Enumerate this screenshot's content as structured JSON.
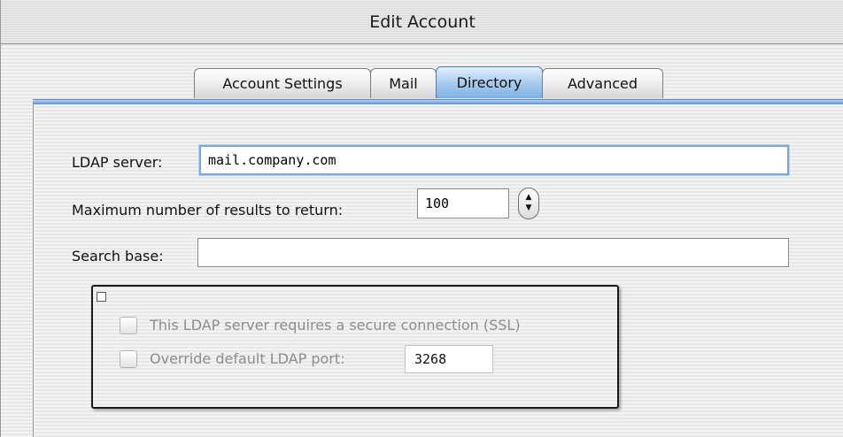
{
  "window": {
    "title": "Edit Account"
  },
  "tabs": [
    {
      "label": "Account Settings",
      "selected": false
    },
    {
      "label": "Mail",
      "selected": false
    },
    {
      "label": "Directory",
      "selected": true
    },
    {
      "label": "Advanced",
      "selected": false
    }
  ],
  "directory": {
    "ldap_server_label": "LDAP server:",
    "ldap_server_value": "mail.company.com",
    "max_results_label": "Maximum number of results to return:",
    "max_results_value": "100",
    "search_base_label": "Search base:",
    "search_base_value": "",
    "ssl_label": "This LDAP server requires a secure connection (SSL)",
    "ssl_checked": false,
    "override_port_label": "Override default LDAP port:",
    "override_port_checked": false,
    "port_value": "3268"
  },
  "icons": {
    "stepper_up": "▲",
    "stepper_down": "▼"
  },
  "colors": {
    "selected_tab": "#a9cdf0",
    "focus_ring": "#7aa8d8",
    "disabled_text": "#8c8c8c"
  }
}
